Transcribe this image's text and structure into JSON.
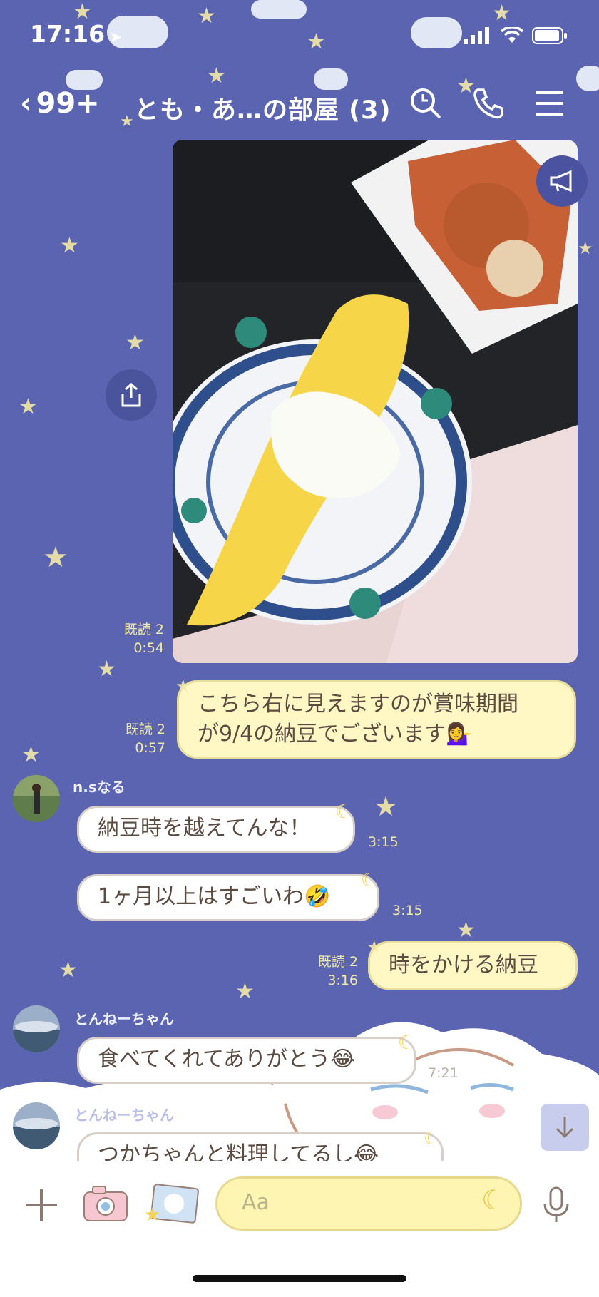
{
  "status_bar": {
    "time": "17:16"
  },
  "header": {
    "back_count": "99+",
    "title": "とも・あ…の部屋 (3)"
  },
  "messages": [
    {
      "read": "既読 2",
      "time": "0:54"
    },
    {
      "read": "既読 2",
      "time": "0:57",
      "text_line1": "こちら右に見えますのが賞味期間",
      "text_line2": "が9/4の納豆でございます💁‍♀️"
    },
    {
      "sender": "n.sなる",
      "text": "納豆時を越えてんな！",
      "time": "3:15"
    },
    {
      "text": "1ヶ月以上はすごいわ🤣",
      "time": "3:15"
    },
    {
      "read": "既読 2",
      "time": "3:16",
      "text": "時をかける納豆"
    },
    {
      "sender": "とんねーちゃん",
      "text": "食べてくれてありがとう😂",
      "time": "7:21"
    },
    {
      "sender": "とんねーちゃん",
      "text": "つかちゃんと料理してるし😂"
    }
  ],
  "input": {
    "placeholder": "Aa"
  },
  "icons": [
    "location-arrow-icon",
    "signal-icon",
    "wifi-icon",
    "battery-icon",
    "search-icon",
    "phone-icon",
    "menu-icon",
    "share-icon",
    "megaphone-icon",
    "plus-icon",
    "camera-icon",
    "photo-icon",
    "moon-icon",
    "mic-icon",
    "arrow-down-icon"
  ],
  "colors": {
    "background": "#5a64b0",
    "bubble_out": "#fff7c4",
    "bubble_in": "#ffffff",
    "accent_yellow": "#f3d35c"
  }
}
